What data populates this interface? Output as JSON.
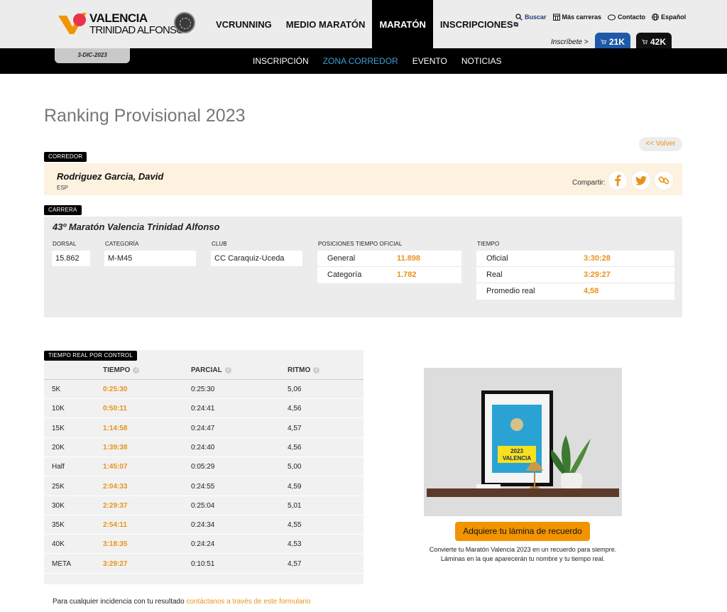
{
  "header": {
    "logo_line1": "VALENCIA",
    "logo_line2": "TRINIDAD ALFONSO",
    "logo_badge": "42K",
    "nav": [
      {
        "label": "VCRUNNING"
      },
      {
        "label": "MEDIO MARATÓN"
      },
      {
        "label": "MARATÓN"
      },
      {
        "label": "INSCRIPCIONES"
      }
    ],
    "utils": {
      "buscar": "Buscar",
      "mas_carreras": "Más carreras",
      "contacto": "Contacto",
      "idioma": "Español"
    },
    "inscribete": "Inscríbete >",
    "cart_21k": "21K",
    "cart_42k": "42K",
    "date_tab": "3-DIC-2023"
  },
  "subnav": [
    "INSCRIPCIÓN",
    "ZONA CORREDOR",
    "EVENTO",
    "NOTICIAS"
  ],
  "page": {
    "title": "Ranking Provisional 2023",
    "back": "<< Volver"
  },
  "runner": {
    "tag": "CORREDOR",
    "name": "Rodriguez Garcia, David",
    "country": "ESP",
    "share_label": "Compartir:"
  },
  "race": {
    "tag": "CARRERA",
    "name": "43º Maratón Valencia Trinidad Alfonso",
    "labels": {
      "dorsal": "DORSAL",
      "categoria": "CATEGORÍA",
      "club": "CLUB",
      "posiciones": "POSICIONES TIEMPO OFICIAL",
      "tiempo": "TIEMPO"
    },
    "dorsal": "15.862",
    "categoria": "M-M45",
    "club": "CC Caraquiz-Uceda",
    "positions": [
      {
        "label": "General",
        "value": "11.898"
      },
      {
        "label": "Categoría",
        "value": "1.782"
      }
    ],
    "times": [
      {
        "label": "Oficial",
        "value": "3:30:28"
      },
      {
        "label": "Real",
        "value": "3:29:27"
      },
      {
        "label": "Promedio real",
        "value": "4,58"
      }
    ]
  },
  "splits": {
    "tag": "TIEMPO REAL POR CONTROL",
    "columns": [
      "TIEMPO",
      "PARCIAL",
      "RITMO"
    ],
    "rows": [
      {
        "point": "5K",
        "tiempo": "0:25:30",
        "parcial": "0:25:30",
        "ritmo": "5,06"
      },
      {
        "point": "10K",
        "tiempo": "0:50:11",
        "parcial": "0:24:41",
        "ritmo": "4,56"
      },
      {
        "point": "15K",
        "tiempo": "1:14:58",
        "parcial": "0:24:47",
        "ritmo": "4,57"
      },
      {
        "point": "20K",
        "tiempo": "1:39:38",
        "parcial": "0:24:40",
        "ritmo": "4,56"
      },
      {
        "point": "Half",
        "tiempo": "1:45:07",
        "parcial": "0:05:29",
        "ritmo": "5,00"
      },
      {
        "point": "25K",
        "tiempo": "2:04:33",
        "parcial": "0:24:55",
        "ritmo": "4,59"
      },
      {
        "point": "30K",
        "tiempo": "2:29:37",
        "parcial": "0:25:04",
        "ritmo": "5,01"
      },
      {
        "point": "35K",
        "tiempo": "2:54:11",
        "parcial": "0:24:34",
        "ritmo": "4,55"
      },
      {
        "point": "40K",
        "tiempo": "3:18:35",
        "parcial": "0:24:24",
        "ritmo": "4,53"
      },
      {
        "point": "META",
        "tiempo": "3:29:27",
        "parcial": "0:10:51",
        "ritmo": "4,57"
      }
    ]
  },
  "footer": {
    "text": "Para cualquier incidencia con tu resultado ",
    "link": "contáctanos a través de este formulario"
  },
  "promo": {
    "poster_year": "2023",
    "poster_city": "VALENCIA",
    "cta": "Adquiere tu lámina de recuerdo",
    "line1": "Convierte tu Maratón Valencia 2023 en un recuerdo para siempre.",
    "line2": "Láminas en la que aparecerán tu nombre y tu tiempo real."
  },
  "colors": {
    "accent": "#e8921a",
    "link_blue": "#3aa0d8",
    "cart_21k": "#1e5aa8",
    "runner_bg": "#fdf1df"
  }
}
